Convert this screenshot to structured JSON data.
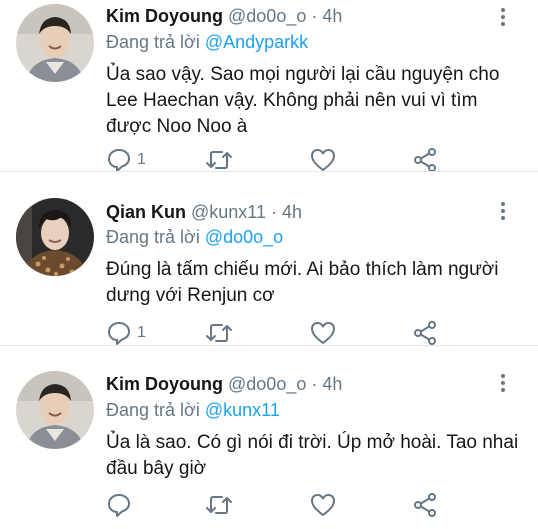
{
  "tweets": [
    {
      "name": "Kim Doyoung",
      "handle": "@do0o_o",
      "separator": "·",
      "time": "4h",
      "reply_prefix": "Đang trả lời",
      "reply_to": "@Andyparkk",
      "text": "Ủa sao vậy. Sao mọi người lại cầu nguyện cho Lee Haechan vậy. Không phải nên vui vì tìm được Noo Noo à",
      "reply_count": "1",
      "avatar_icon": "avatar-photo-man-smiling"
    },
    {
      "name": "Qian Kun",
      "handle": "@kunx11",
      "separator": "·",
      "time": "4h",
      "reply_prefix": "Đang trả lời",
      "reply_to": "@do0o_o",
      "text": "Đúng là tấm chiếu mới. Ai bảo thích làm người dưng với Renjun cơ",
      "reply_count": "1",
      "avatar_icon": "avatar-photo-man-patterned-shirt"
    },
    {
      "name": "Kim Doyoung",
      "handle": "@do0o_o",
      "separator": "·",
      "time": "4h",
      "reply_prefix": "Đang trả lời",
      "reply_to": "@kunx11",
      "text": "Ủa là sao. Có gì nói đi trời. Úp mở hoài. Tao nhai đầu bây giờ",
      "reply_count": "",
      "avatar_icon": "avatar-photo-man-smiling"
    }
  ],
  "colors": {
    "name": "#14171a",
    "muted": "#657786",
    "mention": "#1da1f2",
    "divider": "#e1e8ed"
  }
}
